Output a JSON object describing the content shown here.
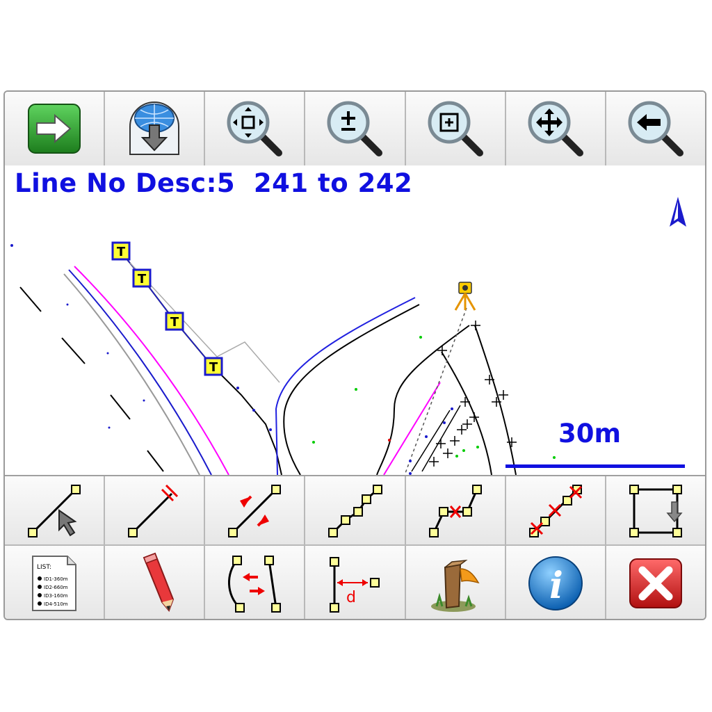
{
  "toolbar_top": {
    "buttons": [
      {
        "name": "next",
        "icon": "green-arrow-right-icon"
      },
      {
        "name": "download-to-map",
        "icon": "globe-download-icon"
      },
      {
        "name": "zoom-extents",
        "icon": "zoom-extents-icon"
      },
      {
        "name": "zoom-in-out",
        "icon": "zoom-plus-minus-icon"
      },
      {
        "name": "zoom-window",
        "icon": "zoom-window-icon"
      },
      {
        "name": "pan",
        "icon": "zoom-pan-icon"
      },
      {
        "name": "zoom-previous",
        "icon": "zoom-back-icon"
      }
    ]
  },
  "map": {
    "line_description": "Line No Desc:5  241 to 242",
    "scale_label": "30m",
    "topo_marker_label": "T",
    "colors": {
      "accent_blue": "#1010e0",
      "line_magenta": "#ff00ff",
      "line_black": "#000000",
      "point_green": "#00cc00"
    }
  },
  "toolbar_bottom_1": {
    "buttons": [
      {
        "name": "select-line",
        "icon": "select-line-icon"
      },
      {
        "name": "parallel-line",
        "icon": "parallel-line-icon"
      },
      {
        "name": "reverse-line",
        "icon": "reverse-line-icon"
      },
      {
        "name": "polyline",
        "icon": "polyline-icon"
      },
      {
        "name": "delete-point",
        "icon": "delete-point-icon"
      },
      {
        "name": "delete-line",
        "icon": "delete-line-icon"
      },
      {
        "name": "rectangle",
        "icon": "rectangle-icon"
      }
    ]
  },
  "toolbar_bottom_2": {
    "list_document_lines": [
      "LIST:",
      "ID1-360m",
      "ID2-660m",
      "ID3-160m",
      "ID4-510m"
    ],
    "offset_label": "d",
    "info_label": "i",
    "buttons": [
      {
        "name": "list",
        "icon": "list-document-icon"
      },
      {
        "name": "edit",
        "icon": "pencil-icon"
      },
      {
        "name": "join-curves",
        "icon": "join-curves-icon"
      },
      {
        "name": "offset-distance",
        "icon": "offset-distance-icon"
      },
      {
        "name": "stakeout",
        "icon": "stake-post-icon"
      },
      {
        "name": "info",
        "icon": "info-icon"
      },
      {
        "name": "close",
        "icon": "close-x-icon"
      }
    ]
  }
}
